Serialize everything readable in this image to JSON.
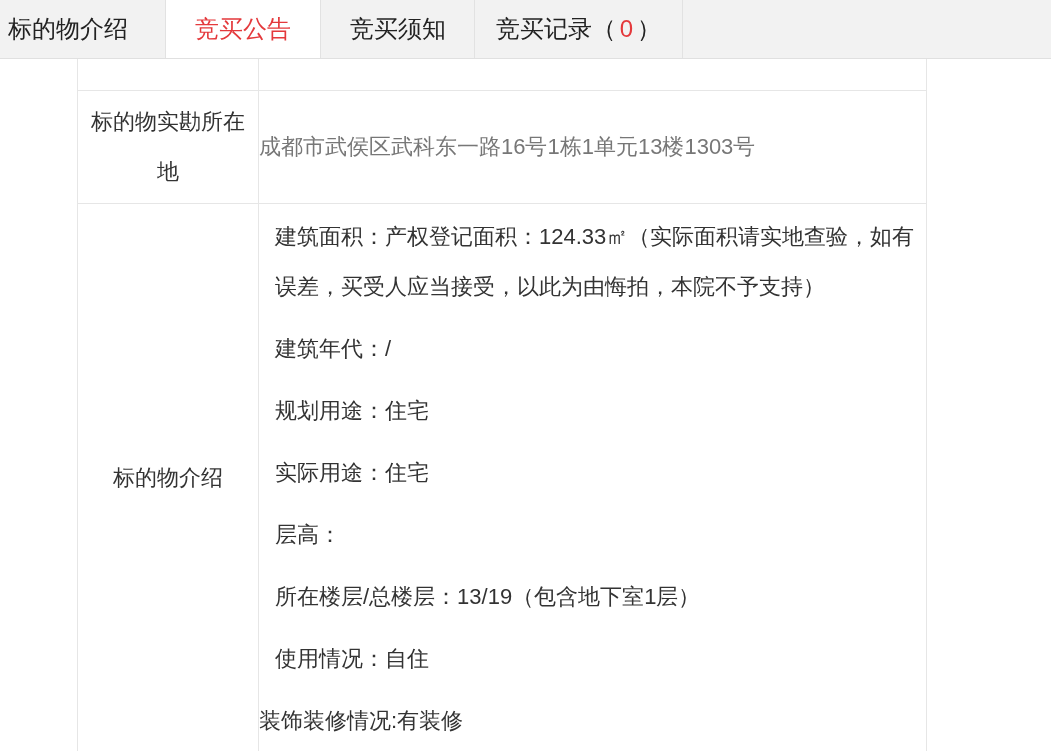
{
  "tabs": [
    {
      "label": "标的物介绍",
      "selected": false
    },
    {
      "label": "竞买公告",
      "selected": true
    },
    {
      "label": "竞买须知",
      "selected": false
    },
    {
      "label": "竞买记录（",
      "count": "0",
      "suffix": "）",
      "selected": false
    }
  ],
  "table": {
    "rows": [
      {
        "kind": "text",
        "label": "标的物实勘所在地",
        "value": "成都市武侯区武科东一路16号1栋1单元13楼1303号",
        "muted": true
      },
      {
        "kind": "paragraphs",
        "label": "标的物介绍",
        "paragraphs": [
          {
            "text": "建筑面积：产权登记面积：124.33㎡（实际面积请实地查验，如有误差，买受人应当接受，以此为由悔拍，本院不予支持）",
            "indented": true
          },
          {
            "text": "建筑年代：/",
            "indented": true
          },
          {
            "text": "规划用途：住宅",
            "indented": true
          },
          {
            "text": "实际用途：住宅",
            "indented": true
          },
          {
            "text": "层高：",
            "indented": true
          },
          {
            "text": "所在楼层/总楼层：13/19（包含地下室1层）",
            "indented": true
          },
          {
            "text": "使用情况：自住",
            "indented": true
          },
          {
            "text": "装饰装修情况:有装修",
            "indented": false
          }
        ]
      }
    ]
  }
}
